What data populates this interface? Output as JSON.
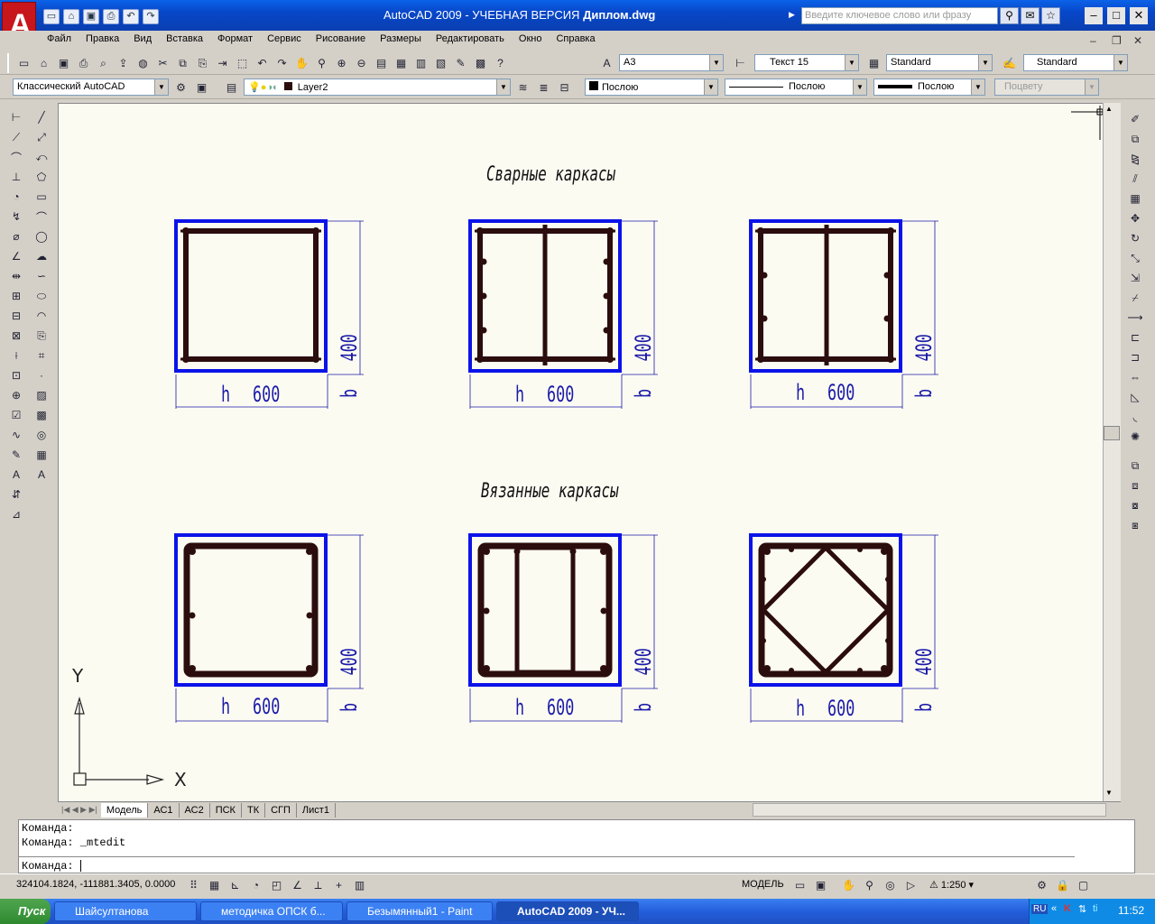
{
  "window": {
    "title": "AutoCAD 2009 - УЧЕБНАЯ ВЕРСИЯ",
    "doc": "Диплом.dwg",
    "search_placeholder": "Введите ключевое слово или фразу"
  },
  "menu": [
    "Файл",
    "Правка",
    "Вид",
    "Вставка",
    "Формат",
    "Сервис",
    "Рисование",
    "Размеры",
    "Редактировать",
    "Окно",
    "Справка"
  ],
  "toolbars": {
    "text_style": "A3",
    "text_size": "Текст 15",
    "dim_style": "Standard",
    "table_style": "Standard",
    "workspace": "Классический AutoCAD",
    "layer": "Layer2",
    "color": "Послою",
    "linetype": "Послою",
    "lineweight": "Послою",
    "plotstyle": "Поцвету"
  },
  "drawing": {
    "heading1": "Сварные каркасы",
    "heading2": "Вязанные каркасы",
    "dim_h_label": "h",
    "dim_h_value": "600",
    "dim_b_label": "b",
    "dim_b_value": "400",
    "ucs_y": "Y",
    "ucs_x": "X"
  },
  "tabs": [
    "Модель",
    "АС1",
    "АС2",
    "ПСК",
    "ТК",
    "СГП",
    "Лист1"
  ],
  "command": {
    "line1": "Команда:",
    "line2": "Команда: _mtedit",
    "prompt": "Команда:"
  },
  "status": {
    "coords": "324104.1824, -111881.3405, 0.0000",
    "space": "МОДЕЛЬ",
    "scale": "1:250"
  },
  "taskbar": {
    "start": "Пуск",
    "tasks": [
      "Шайсултанова",
      "методичка ОПСК б...",
      "Безымянный1 - Paint",
      "AutoCAD 2009 - УЧ..."
    ],
    "lang": "RU",
    "time": "11:52"
  },
  "colors": {
    "frame": "#0b13e8",
    "rebar": "#2b0d0d",
    "dim": "#1a1aa8",
    "paper": "#fcfbf2"
  }
}
